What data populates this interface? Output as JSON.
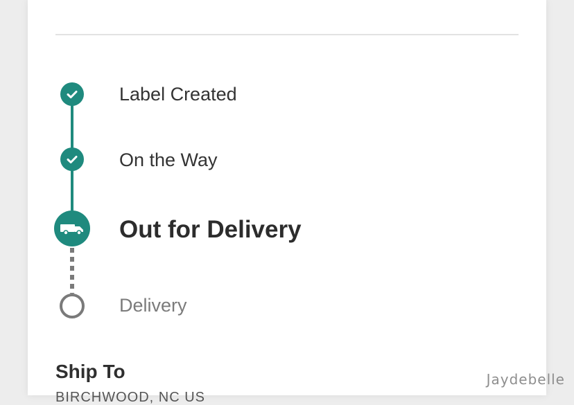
{
  "tracking": {
    "steps": [
      {
        "label": "Label Created",
        "status": "completed",
        "icon": "check-icon"
      },
      {
        "label": "On the Way",
        "status": "completed",
        "icon": "check-icon"
      },
      {
        "label": "Out for Delivery",
        "status": "current",
        "icon": "delivery-truck-icon"
      },
      {
        "label": "Delivery",
        "status": "pending",
        "icon": "empty-circle-icon"
      }
    ],
    "colors": {
      "accent": "#1f8a7e",
      "pending": "#7a7a7a",
      "text_primary": "#333333",
      "text_muted": "#7b7b7b"
    }
  },
  "shipping": {
    "title": "Ship To",
    "address_line": "BIRCHWOOD, NC US"
  },
  "watermark": {
    "text": "Jaydebelle"
  }
}
